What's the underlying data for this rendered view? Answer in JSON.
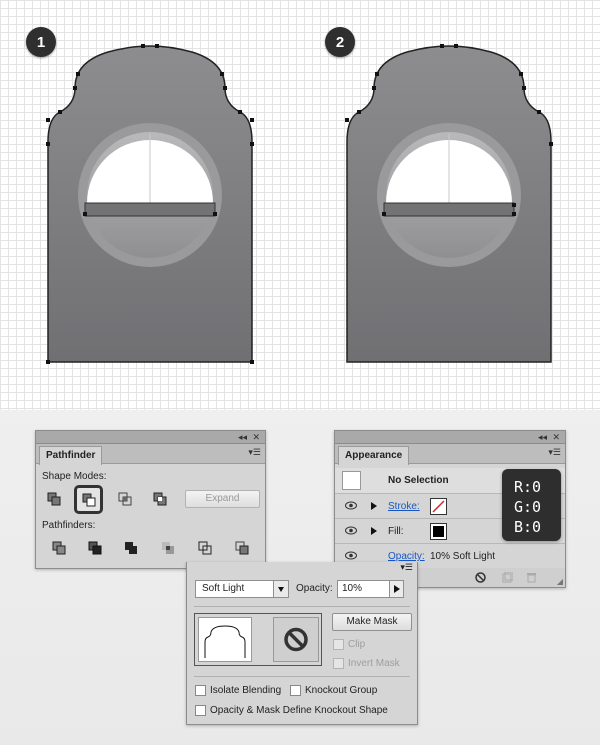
{
  "steps": [
    {
      "number": "1"
    },
    {
      "number": "2"
    }
  ],
  "pathfinder": {
    "tab": "Pathfinder",
    "shape_modes_label": "Shape Modes:",
    "expand_label": "Expand",
    "pathfinders_label": "Pathfinders:",
    "shape_mode_icons": [
      "unite-icon",
      "minus-front-icon",
      "intersect-icon",
      "exclude-icon"
    ],
    "active_shape_mode": "minus-front-icon",
    "pathfinder_icons": [
      "divide-icon",
      "trim-icon",
      "merge-icon",
      "crop-icon",
      "outline-icon",
      "minus-back-icon"
    ]
  },
  "appearance": {
    "tab": "Appearance",
    "selection_label": "No Selection",
    "stroke_label": "Stroke:",
    "fill_label": "Fill:",
    "opacity_label": "Opacity:",
    "opacity_value": "10% Soft Light",
    "fill_color": "#000000"
  },
  "rgb": {
    "r": "R:0",
    "g": "G:0",
    "b": "B:0"
  },
  "transparency": {
    "blend_mode": "Soft Light",
    "opacity_label": "Opacity:",
    "opacity_value": "10%",
    "make_mask_label": "Make Mask",
    "clip_label": "Clip",
    "invert_mask_label": "Invert Mask",
    "isolate_blending_label": "Isolate Blending",
    "knockout_group_label": "Knockout Group",
    "opacity_mask_label": "Opacity & Mask Define Knockout Shape"
  },
  "colors": {
    "shape_top": "#8c8c8e",
    "shape_bottom": "#6f6f72",
    "link": "#1856c4"
  }
}
